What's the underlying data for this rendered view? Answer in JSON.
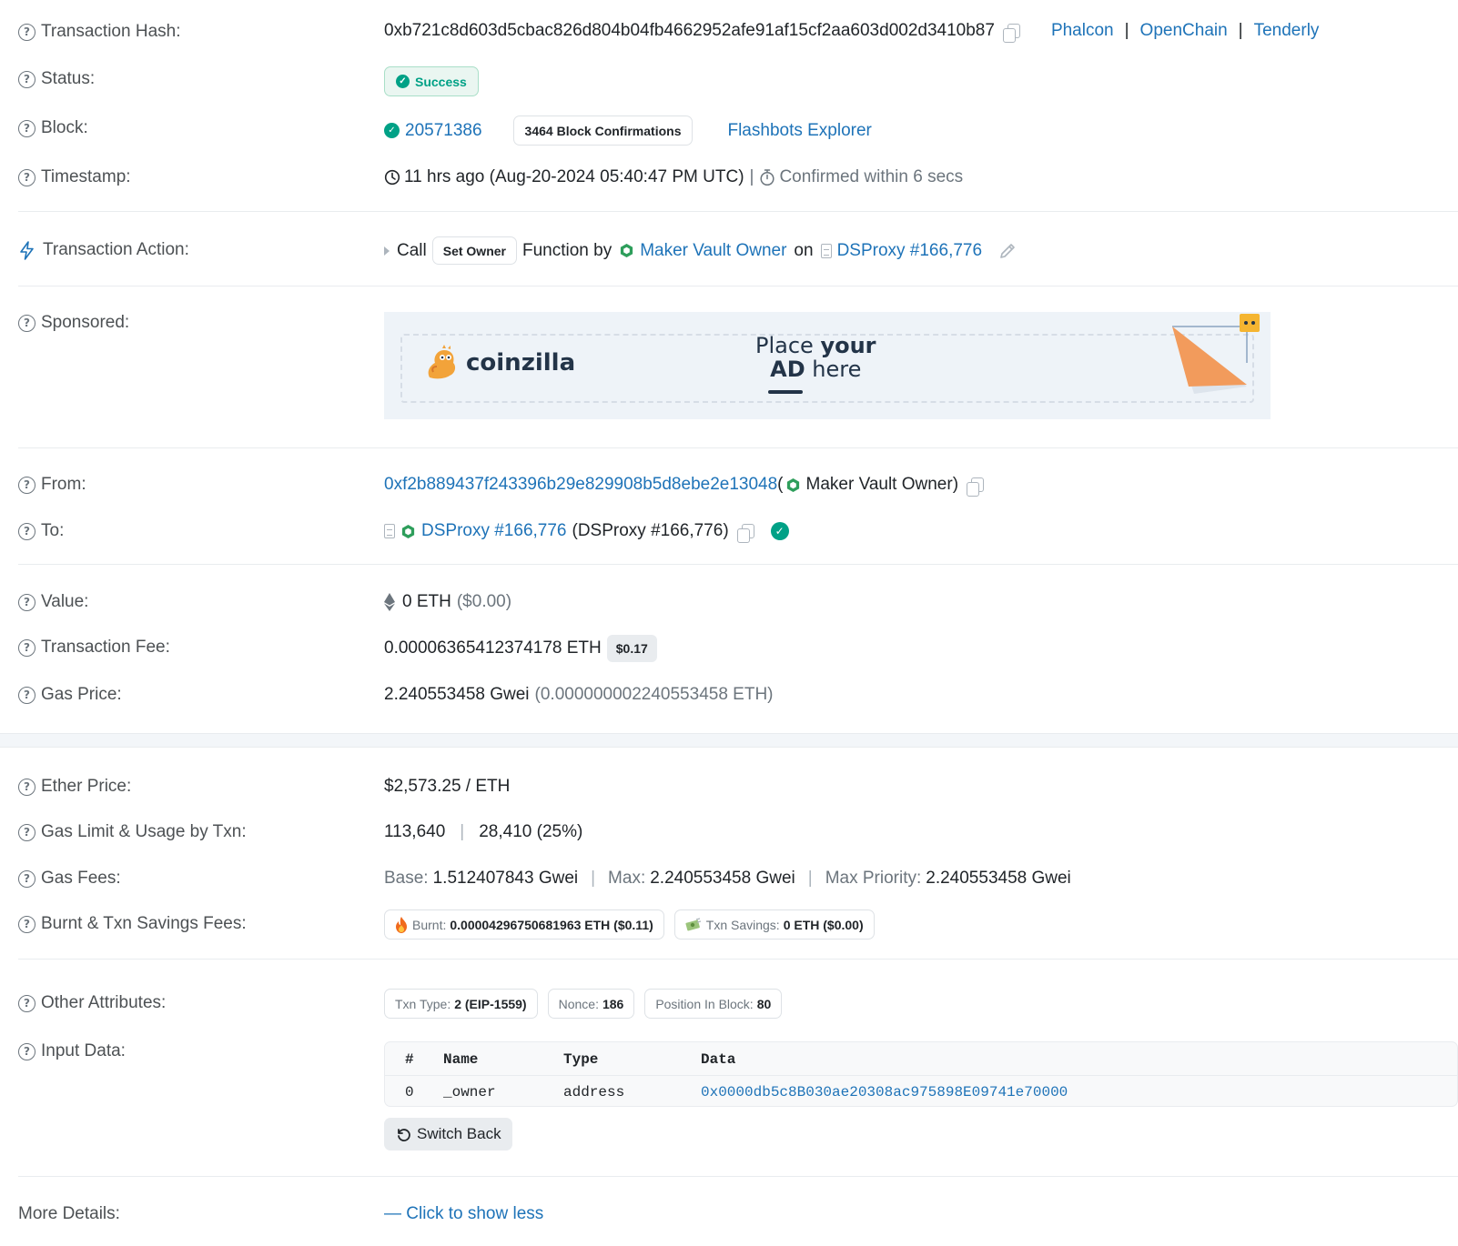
{
  "tx_hash": {
    "label": "Transaction Hash:",
    "value": "0xb721c8d603d5cbac826d804b04fb4662952afe91af15cf2aa603d002d3410b87",
    "links": [
      "Phalcon",
      "OpenChain",
      "Tenderly"
    ],
    "sep": "|"
  },
  "status": {
    "label": "Status:",
    "value": "Success"
  },
  "block": {
    "label": "Block:",
    "number": "20571386",
    "confirmations": "3464 Block Confirmations",
    "explorer": "Flashbots Explorer"
  },
  "timestamp": {
    "label": "Timestamp:",
    "value": "11 hrs ago (Aug-20-2024 05:40:47 PM UTC)",
    "sep": "|",
    "confirmed": "Confirmed within 6 secs"
  },
  "action": {
    "label": "Transaction Action:",
    "call": "Call",
    "method": "Set Owner",
    "function_by": "Function by",
    "by": "Maker Vault Owner",
    "on": "on",
    "contract": "DSProxy #166,776"
  },
  "sponsored": {
    "label": "Sponsored:",
    "brand": "coinzilla",
    "line1_a": "Place ",
    "line1_b": "your",
    "line2_a": "AD",
    "line2_b": " here"
  },
  "from": {
    "label": "From:",
    "address": "0xf2b889437f243396b29e829908b5d8ebe2e13048",
    "open": "(",
    "name": "Maker Vault Owner",
    "close": ")"
  },
  "to": {
    "label": "To:",
    "contract": "DSProxy #166,776",
    "name": "(DSProxy #166,776)"
  },
  "value": {
    "label": "Value:",
    "amount": "0 ETH",
    "usd": "($0.00)"
  },
  "fee": {
    "label": "Transaction Fee:",
    "amount": "0.00006365412374178 ETH",
    "usd": "$0.17"
  },
  "gas_price": {
    "label": "Gas Price:",
    "gwei": "2.240553458 Gwei",
    "eth": "(0.000000002240553458 ETH)"
  },
  "ether_price": {
    "label": "Ether Price:",
    "value": "$2,573.25 / ETH"
  },
  "gas_limit": {
    "label": "Gas Limit & Usage by Txn:",
    "limit": "113,640",
    "sep": "|",
    "usage": "28,410 (25%)"
  },
  "gas_fees": {
    "label": "Gas Fees:",
    "base_label": "Base:",
    "base": "1.512407843 Gwei",
    "max_label": "Max:",
    "max": "2.240553458 Gwei",
    "prio_label": "Max Priority:",
    "prio": "2.240553458 Gwei",
    "sep": "|"
  },
  "burnt": {
    "label": "Burnt & Txn Savings Fees:",
    "burnt_label": "Burnt:",
    "burnt": "0.00004296750681963 ETH ($0.11)",
    "savings_label": "Txn Savings:",
    "savings": "0 ETH ($0.00)"
  },
  "other": {
    "label": "Other Attributes:",
    "type_label": "Txn Type:",
    "type": "2 (EIP-1559)",
    "nonce_label": "Nonce:",
    "nonce": "186",
    "pos_label": "Position In Block:",
    "pos": "80"
  },
  "input": {
    "label": "Input Data:",
    "headers": [
      "#",
      "Name",
      "Type",
      "Data"
    ],
    "rows": [
      [
        "0",
        "_owner",
        "address",
        "0x0000db5c8B030ae20308ac975898E09741e70000"
      ]
    ],
    "switch": "Switch Back"
  },
  "more": {
    "label": "More Details:",
    "toggle": "— Click to show less"
  },
  "colors": {
    "link": "#1e73b8",
    "success": "#00a186",
    "muted": "#6c757d"
  },
  "icons": [
    "question-circle-icon",
    "lightning-icon",
    "copy-icon",
    "clock-icon",
    "stopwatch-icon",
    "ethereum-icon",
    "fire-icon",
    "money-icon",
    "undo-icon",
    "pencil-icon",
    "document-icon",
    "hexagon-icon"
  ]
}
